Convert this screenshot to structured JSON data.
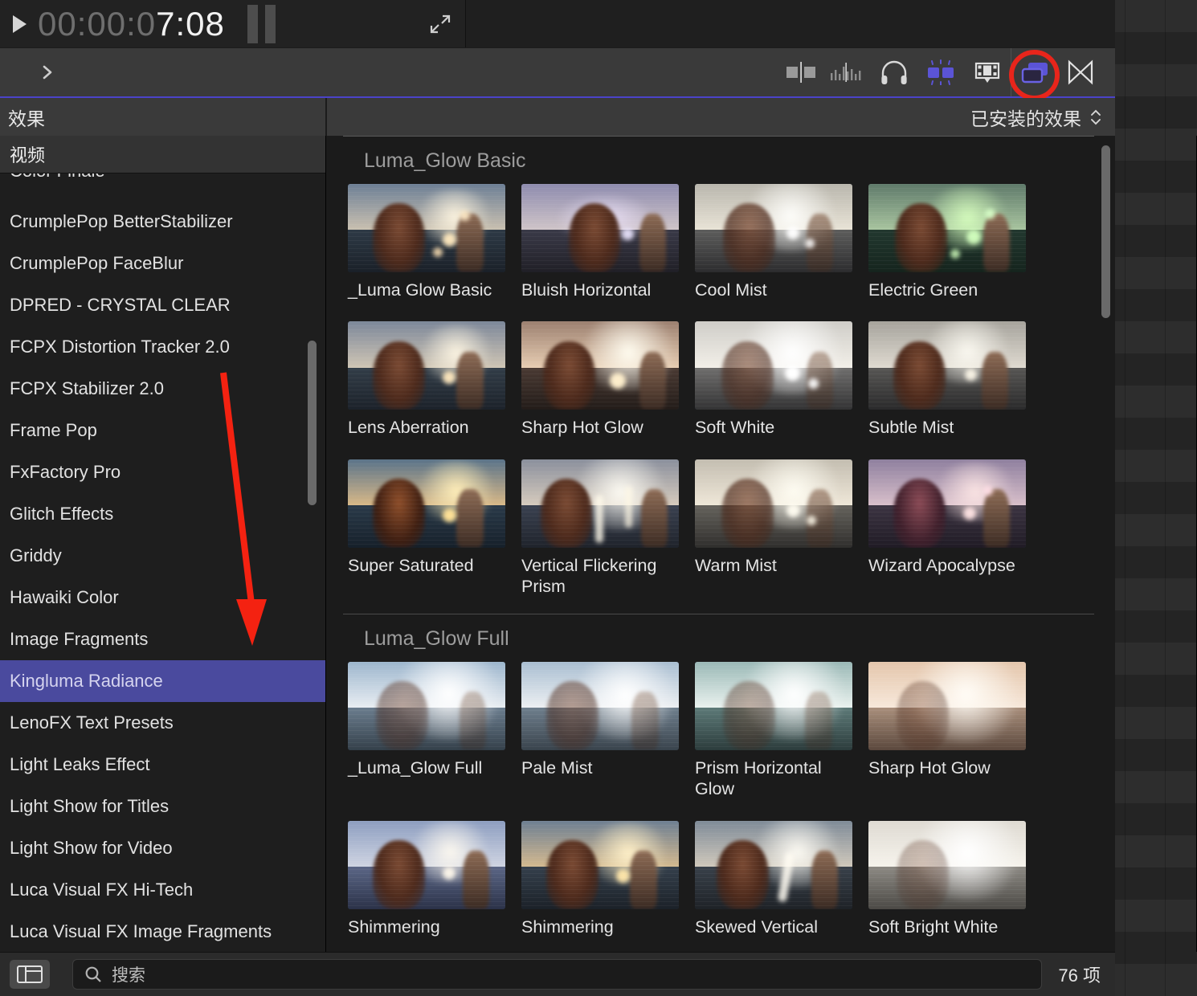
{
  "viewer": {
    "timecode_dim": "00:00:0",
    "timecode_bright": "7:08",
    "play_icon": "play-triangle-icon",
    "pause_icon": "pause-bars-icon",
    "expand_icon": "expand-arrows-icon"
  },
  "toolbar": {
    "disclosure_icon": "chevron-right-icon",
    "buttons": [
      {
        "name": "transition-browser-icon",
        "label": "",
        "active": false
      },
      {
        "name": "audio-waveform-icon",
        "label": "",
        "active": false
      },
      {
        "name": "headphones-icon",
        "label": "",
        "active": false
      },
      {
        "name": "titles-generators-icon",
        "label": "",
        "active": true
      },
      {
        "name": "filmstrip-icon",
        "label": "",
        "active": false
      },
      {
        "name": "effects-browser-icon",
        "label": "",
        "active": true,
        "annotated": true
      },
      {
        "name": "transitions-bowtie-icon",
        "label": "",
        "active": false
      }
    ],
    "accent_color": "#5b54d6",
    "annotation_color": "#e8251b"
  },
  "panel_header": {
    "sidebar_title": "效果",
    "installed_label": "已安装的效果",
    "stepper_icon": "chevron-up-down-icon"
  },
  "sidebar": {
    "category": "视频",
    "selected": "Kingluma Radiance",
    "selected_color": "#4a4a9e",
    "items": [
      {
        "label": "Color Finale",
        "clipped": true
      },
      {
        "label": "CrumplePop BetterStabilizer"
      },
      {
        "label": "CrumplePop FaceBlur"
      },
      {
        "label": "DPRED - CRYSTAL CLEAR"
      },
      {
        "label": "FCPX Distortion Tracker 2.0"
      },
      {
        "label": "FCPX Stabilizer 2.0"
      },
      {
        "label": "Frame Pop"
      },
      {
        "label": "FxFactory Pro"
      },
      {
        "label": "Glitch Effects"
      },
      {
        "label": "Griddy"
      },
      {
        "label": "Hawaiki Color"
      },
      {
        "label": "Image Fragments"
      },
      {
        "label": "Kingluma Radiance"
      },
      {
        "label": "LenoFX Text Presets"
      },
      {
        "label": "Light Leaks Effect"
      },
      {
        "label": "Light Show for Titles"
      },
      {
        "label": "Light Show for Video"
      },
      {
        "label": "Luca Visual FX Hi-Tech"
      },
      {
        "label": "Luca Visual FX Image Fragments"
      }
    ]
  },
  "groups": [
    {
      "title": "Luma_Glow Basic",
      "rows": [
        [
          {
            "label": "_Luma Glow Basic",
            "look": "warm"
          },
          {
            "label": "Bluish Horizontal",
            "look": "bluish"
          },
          {
            "label": "Cool Mist",
            "look": "coolmist"
          },
          {
            "label": "Electric Green",
            "look": "green"
          }
        ],
        [
          {
            "label": "Lens Aberration",
            "look": "warm"
          },
          {
            "label": "Sharp Hot Glow",
            "look": "hot"
          },
          {
            "label": "Soft White",
            "look": "white"
          },
          {
            "label": "Subtle Mist",
            "look": "subtle"
          }
        ],
        [
          {
            "label": "Super Saturated",
            "look": "sat"
          },
          {
            "label": "Vertical Flickering Prism",
            "look": "prism"
          },
          {
            "label": "Warm Mist",
            "look": "warmmist"
          },
          {
            "label": "Wizard Apocalypse",
            "look": "wizard"
          }
        ]
      ]
    },
    {
      "title": "Luma_Glow Full",
      "rows": [
        [
          {
            "label": "_Luma_Glow Full",
            "look": "pale"
          },
          {
            "label": "Pale Mist",
            "look": "palemist"
          },
          {
            "label": "Prism Horizontal Glow",
            "look": "prismh"
          },
          {
            "label": "Sharp Hot Glow",
            "look": "hot2"
          }
        ],
        [
          {
            "label": "Shimmering",
            "look": "shim1"
          },
          {
            "label": "Shimmering",
            "look": "shim2"
          },
          {
            "label": "Skewed Vertical",
            "look": "skew"
          },
          {
            "label": "Soft Bright White",
            "look": "softbright"
          }
        ]
      ]
    }
  ],
  "bottom_bar": {
    "sidebar_toggle_icon": "sidebar-layout-icon",
    "search_icon": "search-icon",
    "search_placeholder": "搜索",
    "search_value": "",
    "item_count": "76 项"
  }
}
